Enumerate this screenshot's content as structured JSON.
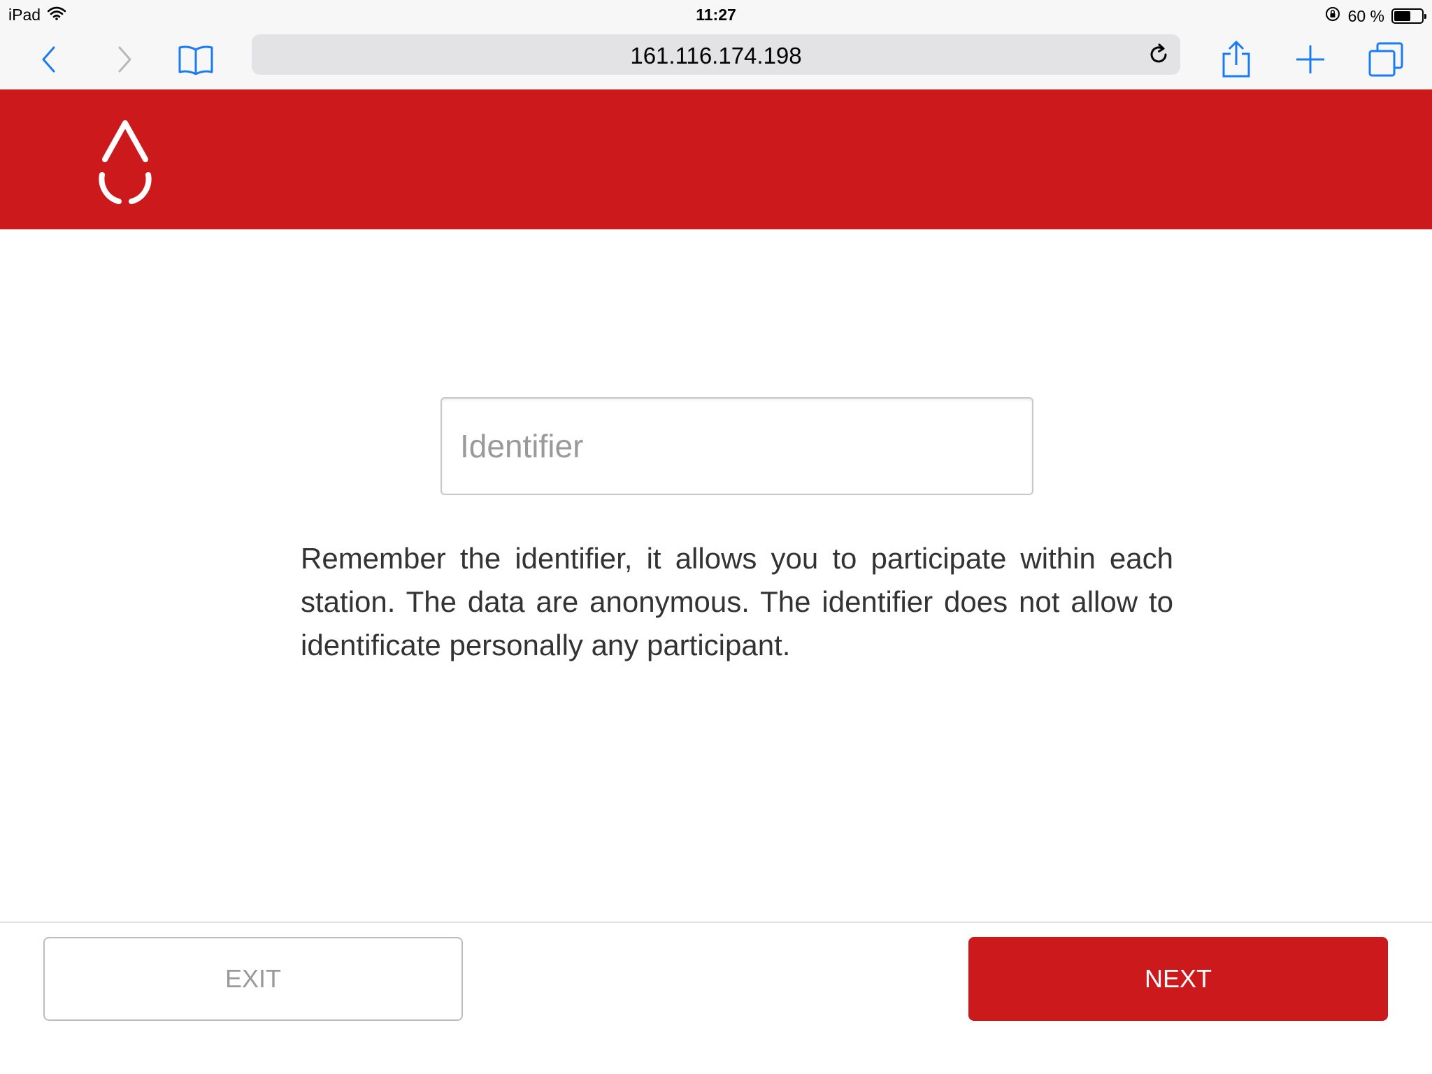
{
  "status_bar": {
    "device": "iPad",
    "time": "11:27",
    "battery_text": "60 %",
    "battery_level": 0.6,
    "icons": [
      "wifi-icon",
      "rotation-lock-icon",
      "battery-icon"
    ]
  },
  "browser": {
    "url": "161.116.174.198",
    "icons": [
      "back-icon",
      "forward-icon",
      "bookmarks-icon",
      "reload-icon",
      "share-icon",
      "new-tab-icon",
      "tabs-icon"
    ],
    "accent_color": "#1a7cf5"
  },
  "header": {
    "brand_color": "#cc1a1c",
    "logo": "blood-drop-logo"
  },
  "form": {
    "identifier_value": "",
    "identifier_placeholder": "Identifier",
    "info_text": "Remember the identifier, it allows you to participate within each station. The data are anonymous. The identifier does not allow to identificate personally any participant."
  },
  "footer": {
    "exit_label": "EXIT",
    "next_label": "NEXT"
  }
}
